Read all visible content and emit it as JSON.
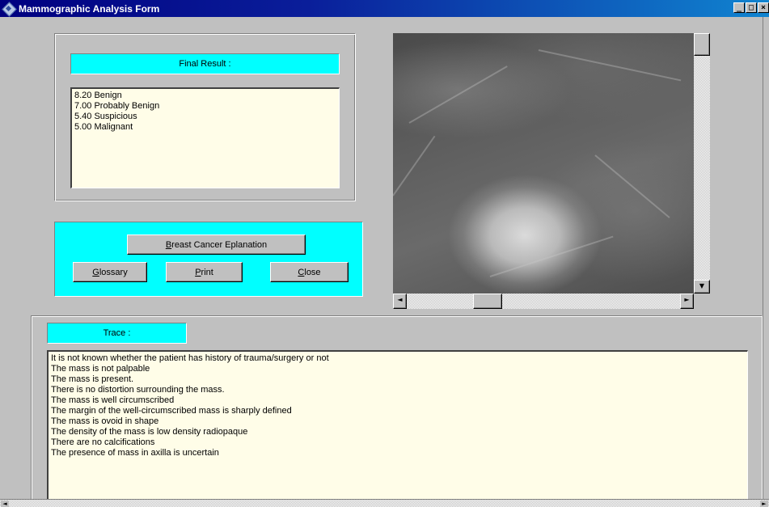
{
  "window": {
    "title": "Mammographic Analysis Form",
    "minimize": "_",
    "maximize": "□",
    "close": "×"
  },
  "result": {
    "label": "Final Result :",
    "items": [
      "8.20 Benign",
      "7.00 Probably Benign",
      "5.40 Suspicious",
      "5.00 Malignant"
    ]
  },
  "buttons": {
    "explanation": {
      "accel": "B",
      "rest": "reast Cancer Eplanation"
    },
    "glossary": {
      "accel": "G",
      "rest": "lossary"
    },
    "print": {
      "accel": "P",
      "rest": "rint"
    },
    "close": {
      "accel": "C",
      "rest": "lose"
    }
  },
  "scroll": {
    "up": "▲",
    "down": "▼",
    "left": "◄",
    "right": "►"
  },
  "trace": {
    "label": "Trace :",
    "lines": [
      "It is not known whether the patient has history of trauma/surgery or not",
      "The mass is not palpable",
      "The mass is present.",
      "There is no distortion surrounding the mass.",
      "The mass is well circumscribed",
      "The margin of the well-circumscribed mass is sharply defined",
      "The mass is ovoid in shape",
      "The density of the mass is low density radiopaque",
      "There are no calcifications",
      "The presence of mass in axilla is uncertain"
    ]
  },
  "colors": {
    "label_bg": "#00ffff",
    "list_bg": "#fffde8",
    "face": "#c0c0c0",
    "title_bar": "#000080"
  },
  "icons": {
    "app": "app-icon",
    "image": "mammogram-image"
  }
}
